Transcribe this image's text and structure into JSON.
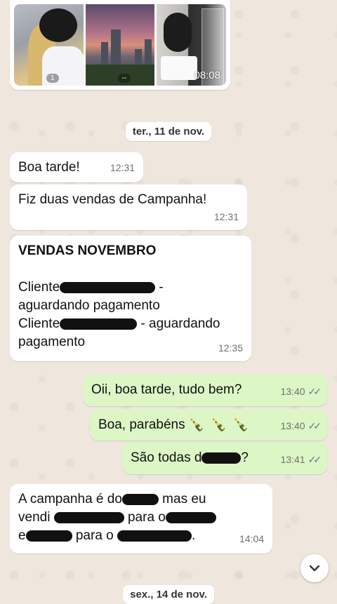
{
  "media": {
    "time": "08:08",
    "thumbs": [
      {
        "badge": "1"
      },
      {
        "badge": "--"
      },
      {
        "badge": ""
      }
    ]
  },
  "dates": {
    "first": "ter., 11 de nov.",
    "second": "sex., 14 de nov."
  },
  "messages": {
    "m1": {
      "text": "Boa tarde!",
      "time": "12:31"
    },
    "m2": {
      "text": "Fiz duas vendas de Campanha!",
      "time": "12:31"
    },
    "m3": {
      "heading": "VENDAS NOVEMBRO",
      "line1_prefix": "Cliente",
      "line1_suffix": " -",
      "line2": "aguardando pagamento",
      "line3_prefix": "Cliente",
      "line3_suffix": " - aguardando",
      "line4": "pagamento",
      "time": "12:35"
    },
    "m4": {
      "text": "Oii, boa tarde, tudo bem?",
      "time": "13:40"
    },
    "m5": {
      "text": "Boa, parabéns",
      "emoji": "🍾 🍾 🍾",
      "time": "13:40"
    },
    "m6": {
      "text_prefix": "São todas d",
      "text_suffix": "?",
      "time": "13:41"
    },
    "m7": {
      "l1_a": "A campanha é do",
      "l1_b": " mas eu",
      "l2_a": "vendi",
      "l2_b": "para o",
      "l3_a": "e",
      "l3_b": "para o",
      "l3_c": ".",
      "time": "14:04"
    }
  },
  "icons": {
    "read": "double-check-icon",
    "scroll": "chevron-down-icon"
  },
  "colors": {
    "background": "#efe7de",
    "incoming": "#ffffff",
    "outgoing": "#dcf7c5",
    "read_check": "#5d7d8f"
  }
}
